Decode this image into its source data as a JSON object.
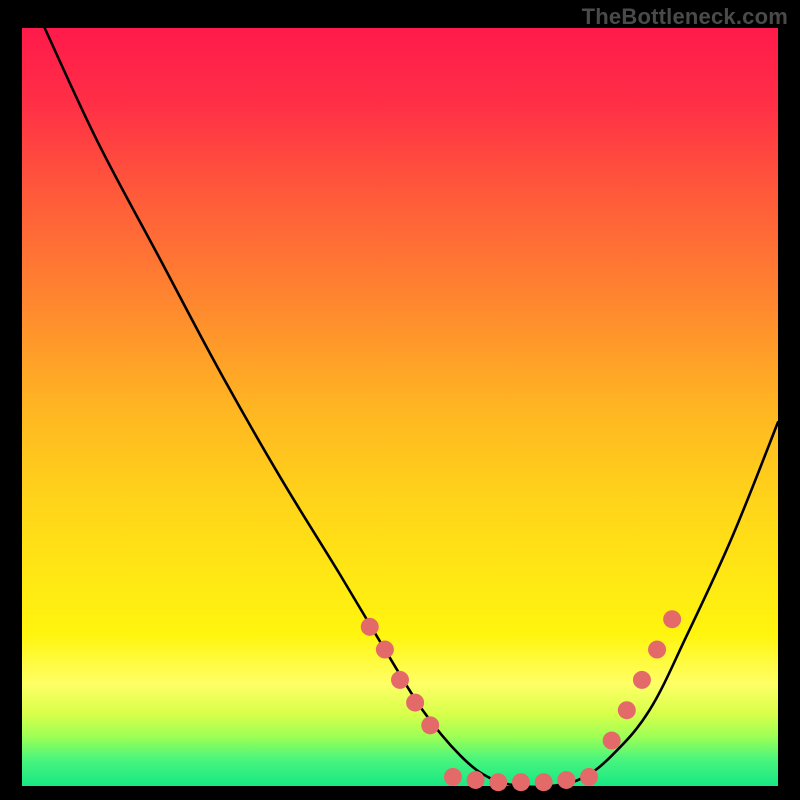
{
  "watermark": "TheBottleneck.com",
  "layout": {
    "outer_w": 800,
    "outer_h": 800,
    "inner_x": 22,
    "inner_y": 28,
    "inner_w": 756,
    "inner_h": 758
  },
  "gradient": {
    "stops": [
      {
        "offset": 0.0,
        "color": "#ff1a4b"
      },
      {
        "offset": 0.1,
        "color": "#ff2f46"
      },
      {
        "offset": 0.22,
        "color": "#ff5a3a"
      },
      {
        "offset": 0.35,
        "color": "#ff8330"
      },
      {
        "offset": 0.5,
        "color": "#ffb522"
      },
      {
        "offset": 0.62,
        "color": "#ffd31a"
      },
      {
        "offset": 0.72,
        "color": "#ffe714"
      },
      {
        "offset": 0.8,
        "color": "#fff50e"
      },
      {
        "offset": 0.865,
        "color": "#ffff66"
      },
      {
        "offset": 0.905,
        "color": "#d7ff4a"
      },
      {
        "offset": 0.935,
        "color": "#9dff55"
      },
      {
        "offset": 0.965,
        "color": "#49f57d"
      },
      {
        "offset": 1.0,
        "color": "#17e884"
      }
    ]
  },
  "chart_data": {
    "type": "line",
    "title": "",
    "xlabel": "",
    "ylabel": "",
    "xlim": [
      0,
      100
    ],
    "ylim": [
      0,
      100
    ],
    "series": [
      {
        "name": "bottleneck-curve",
        "x": [
          3,
          10,
          18,
          26,
          34,
          42,
          48,
          53,
          58,
          62,
          66,
          70,
          74,
          78,
          83,
          88,
          94,
          100
        ],
        "values": [
          100,
          85,
          70,
          55,
          41,
          28,
          18,
          10,
          4,
          1,
          0,
          0,
          1,
          4,
          10,
          20,
          33,
          48
        ]
      }
    ],
    "markers": {
      "name": "highlight-dots",
      "color": "#e46a6a",
      "radius": 9,
      "points": [
        {
          "x": 46,
          "y": 21
        },
        {
          "x": 48,
          "y": 18
        },
        {
          "x": 50,
          "y": 14
        },
        {
          "x": 52,
          "y": 11
        },
        {
          "x": 54,
          "y": 8
        },
        {
          "x": 57,
          "y": 1.2
        },
        {
          "x": 60,
          "y": 0.8
        },
        {
          "x": 63,
          "y": 0.5
        },
        {
          "x": 66,
          "y": 0.5
        },
        {
          "x": 69,
          "y": 0.5
        },
        {
          "x": 72,
          "y": 0.8
        },
        {
          "x": 75,
          "y": 1.2
        },
        {
          "x": 78,
          "y": 6
        },
        {
          "x": 80,
          "y": 10
        },
        {
          "x": 82,
          "y": 14
        },
        {
          "x": 84,
          "y": 18
        },
        {
          "x": 86,
          "y": 22
        }
      ]
    }
  }
}
